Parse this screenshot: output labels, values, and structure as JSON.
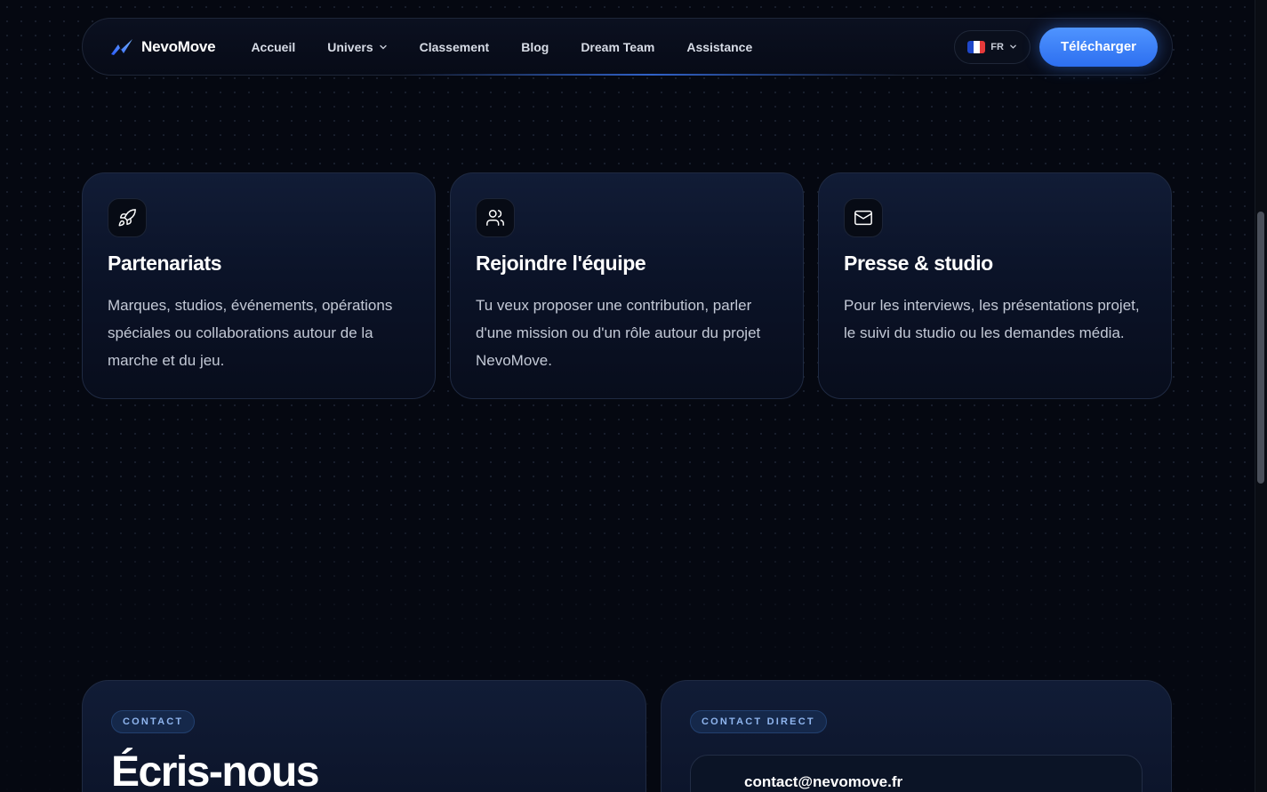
{
  "nav": {
    "brand": "NevoMove",
    "links": [
      {
        "label": "Accueil"
      },
      {
        "label": "Univers",
        "dropdown": true
      },
      {
        "label": "Classement"
      },
      {
        "label": "Blog"
      },
      {
        "label": "Dream Team"
      },
      {
        "label": "Assistance"
      }
    ],
    "language": "FR",
    "download_label": "Télécharger"
  },
  "cards": [
    {
      "icon": "rocket-icon",
      "title": "Partenariats",
      "text": "Marques, studios, événements, opérations spéciales ou collaborations autour de la marche et du jeu."
    },
    {
      "icon": "users-icon",
      "title": "Rejoindre l'équipe",
      "text": "Tu veux proposer une contribution, parler d'une mission ou d'un rôle autour du projet NevoMove."
    },
    {
      "icon": "mail-icon",
      "title": "Presse & studio",
      "text": "Pour les interviews, les présentations projet, le suivi du studio ou les demandes média."
    }
  ],
  "contact": {
    "pill": "CONTACT",
    "heading": "Écris-nous"
  },
  "direct": {
    "pill": "CONTACT DIRECT",
    "email": "contact@nevomove.fr"
  },
  "colors": {
    "accent": "#3b82f6",
    "background": "#050811",
    "card": "#0b1328"
  }
}
